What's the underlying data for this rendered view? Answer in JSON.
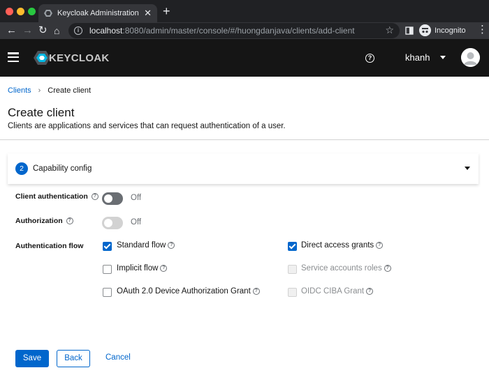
{
  "browser": {
    "tab_title": "Keycloak Administration Conso",
    "url_host": "localhost",
    "url_rest": ":8080/admin/master/console/#/huongdanjava/clients/add-client",
    "incognito_label": "Incognito"
  },
  "masthead": {
    "logo_text": "KEYCLOAK",
    "user_name": "khanh"
  },
  "breadcrumb": {
    "parent": "Clients",
    "current": "Create client"
  },
  "page": {
    "title": "Create client",
    "description": "Clients are applications and services that can request authentication of a user."
  },
  "wizard": {
    "step_number": "2",
    "step_label": "Capability config"
  },
  "form": {
    "client_authentication": {
      "label": "Client authentication",
      "value": "Off"
    },
    "authorization": {
      "label": "Authorization",
      "value": "Off"
    },
    "authentication_flow": {
      "label": "Authentication flow",
      "options": {
        "standard_flow": {
          "label": "Standard flow",
          "checked": true
        },
        "direct_access_grants": {
          "label": "Direct access grants",
          "checked": true
        },
        "implicit_flow": {
          "label": "Implicit flow",
          "checked": false
        },
        "service_accounts_roles": {
          "label": "Service accounts roles",
          "checked": false,
          "disabled": true
        },
        "oauth_device_grant": {
          "label": "OAuth 2.0 Device Authorization Grant",
          "checked": false
        },
        "oidc_ciba_grant": {
          "label": "OIDC CIBA Grant",
          "checked": false,
          "disabled": true
        }
      }
    }
  },
  "actions": {
    "save": "Save",
    "back": "Back",
    "cancel": "Cancel"
  },
  "colors": {
    "primary": "#0066cc",
    "masthead": "#151515",
    "text": "#151515",
    "muted": "#6a6e73"
  }
}
